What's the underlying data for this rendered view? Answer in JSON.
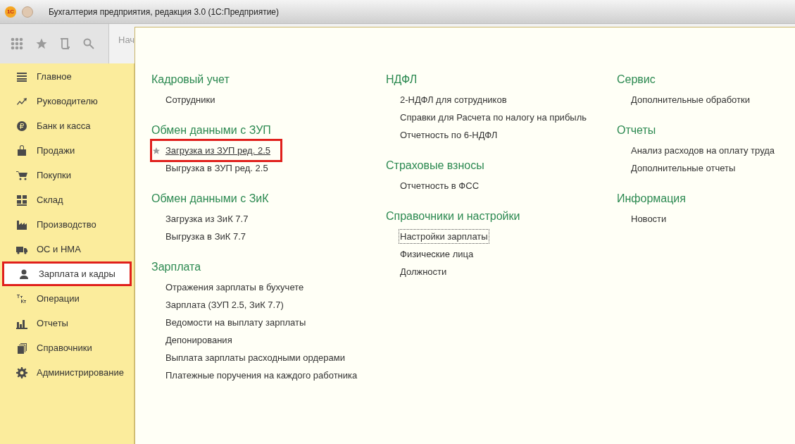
{
  "window": {
    "logo": "1С",
    "title": "Бухгалтерия предприятия, редакция 3.0  (1С:Предприятие)"
  },
  "tab_partial": "Нач",
  "sidebar": {
    "items": [
      {
        "label": "Главное",
        "selected": false,
        "highlighted": false
      },
      {
        "label": "Руководителю",
        "selected": false,
        "highlighted": false
      },
      {
        "label": "Банк и касса",
        "selected": false,
        "highlighted": false
      },
      {
        "label": "Продажи",
        "selected": false,
        "highlighted": false
      },
      {
        "label": "Покупки",
        "selected": false,
        "highlighted": false
      },
      {
        "label": "Склад",
        "selected": false,
        "highlighted": false
      },
      {
        "label": "Производство",
        "selected": false,
        "highlighted": false
      },
      {
        "label": "ОС и НМА",
        "selected": false,
        "highlighted": false
      },
      {
        "label": "Зарплата и кадры",
        "selected": true,
        "highlighted": true
      },
      {
        "label": "Операции",
        "selected": false,
        "highlighted": false
      },
      {
        "label": "Отчеты",
        "selected": false,
        "highlighted": false
      },
      {
        "label": "Справочники",
        "selected": false,
        "highlighted": false
      },
      {
        "label": "Администрирование",
        "selected": false,
        "highlighted": false
      }
    ]
  },
  "columns": [
    {
      "groups": [
        {
          "title": "Кадровый учет",
          "items": [
            {
              "label": "Сотрудники",
              "starred": false,
              "highlighted": false,
              "focused": false
            }
          ]
        },
        {
          "title": "Обмен данными с ЗУП",
          "items": [
            {
              "label": "Загрузка из ЗУП ред. 2.5",
              "starred": true,
              "highlighted": true,
              "focused": false
            },
            {
              "label": "Выгрузка в ЗУП ред. 2.5",
              "starred": false,
              "highlighted": false,
              "focused": false
            }
          ]
        },
        {
          "title": "Обмен данными с ЗиК",
          "items": [
            {
              "label": "Загрузка из ЗиК 7.7",
              "starred": false,
              "highlighted": false,
              "focused": false
            },
            {
              "label": "Выгрузка в ЗиК 7.7",
              "starred": false,
              "highlighted": false,
              "focused": false
            }
          ]
        },
        {
          "title": "Зарплата",
          "items": [
            {
              "label": "Отражения зарплаты в бухучете",
              "starred": false,
              "highlighted": false,
              "focused": false
            },
            {
              "label": "Зарплата (ЗУП 2.5, ЗиК 7.7)",
              "starred": false,
              "highlighted": false,
              "focused": false
            },
            {
              "label": "Ведомости на выплату зарплаты",
              "starred": false,
              "highlighted": false,
              "focused": false
            },
            {
              "label": "Депонирования",
              "starred": false,
              "highlighted": false,
              "focused": false
            },
            {
              "label": "Выплата зарплаты расходными ордерами",
              "starred": false,
              "highlighted": false,
              "focused": false
            },
            {
              "label": "Платежные поручения на каждого работника",
              "starred": false,
              "highlighted": false,
              "focused": false
            }
          ]
        }
      ]
    },
    {
      "groups": [
        {
          "title": "НДФЛ",
          "items": [
            {
              "label": "2-НДФЛ для сотрудников",
              "starred": false,
              "highlighted": false,
              "focused": false
            },
            {
              "label": "Справки для Расчета по налогу на прибыль",
              "starred": false,
              "highlighted": false,
              "focused": false
            },
            {
              "label": "Отчетность по 6-НДФЛ",
              "starred": false,
              "highlighted": false,
              "focused": false
            }
          ]
        },
        {
          "title": "Страховые взносы",
          "items": [
            {
              "label": "Отчетность в ФСС",
              "starred": false,
              "highlighted": false,
              "focused": false
            }
          ]
        },
        {
          "title": "Справочники и настройки",
          "items": [
            {
              "label": "Настройки зарплаты",
              "starred": false,
              "highlighted": false,
              "focused": true
            },
            {
              "label": "Физические лица",
              "starred": false,
              "highlighted": false,
              "focused": false
            },
            {
              "label": "Должности",
              "starred": false,
              "highlighted": false,
              "focused": false
            }
          ]
        }
      ]
    },
    {
      "groups": [
        {
          "title": "Сервис",
          "items": [
            {
              "label": "Дополнительные обработки",
              "starred": false,
              "highlighted": false,
              "focused": false
            }
          ]
        },
        {
          "title": "Отчеты",
          "items": [
            {
              "label": "Анализ расходов на оплату труда",
              "starred": false,
              "highlighted": false,
              "focused": false
            },
            {
              "label": "Дополнительные отчеты",
              "starred": false,
              "highlighted": false,
              "focused": false
            }
          ]
        },
        {
          "title": "Информация",
          "items": [
            {
              "label": "Новости",
              "starred": false,
              "highlighted": false,
              "focused": false
            }
          ]
        }
      ]
    }
  ]
}
